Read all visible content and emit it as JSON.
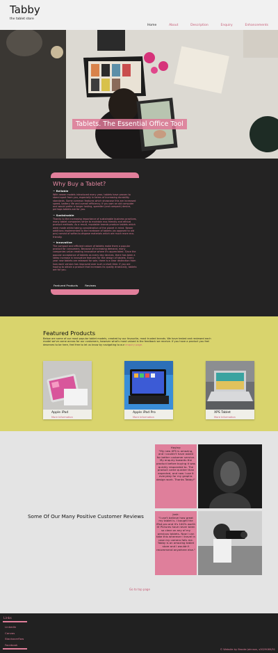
{
  "header": {
    "title": "Tabby",
    "subtitle": "the tablet store"
  },
  "nav": {
    "items": [
      "Home",
      "About",
      "Description",
      "Enquiry",
      "Enhancements"
    ]
  },
  "hero": {
    "title": "Tablets. The Essential Office Tool"
  },
  "why": {
    "heading": "Why Buy a Tablet?",
    "sections": [
      {
        "title": "~ Reliable",
        "text": "With newer models introduced every year, tablets have proven to stand apart from you, especially in terms of increasing durability standards. Some common features which showcase this are increased speed, battery life and overall efficiency. If you own an old computer and would prefer a longer lasting, speedier (and compact) device, perhaps tablets are for you."
      },
      {
        "title": "~ Sustainable",
        "text": "Thanks to the increasing importance of sustainable business practices, many tablet companies strive to maintain eco-friendly and ethical product methods. As a result, reputable brands produce tablets which were made whilst taking consideration of the planet in mind. Newer additions implemented to the hardware of tablets (as opposed to old pcs) consist of softer-to-dispose materials which are much more eco-friendly."
      },
      {
        "title": "~ Innovative",
        "text": "The compact and efficient nature of tablets make them a popular product for consumers. Because of increasing demand, many companies value creating innovative where it's appreciated. Since the popular acceptance of tablets as every day devices, there has been a steep increase in innovative features for the design of tablets. Every year new tablets are released for sale, there is a clear distinction from how each version has improved over such a short time. If you are hoping to obtain a product that increases its quality drastically, tablets are for you."
      }
    ],
    "tabs": [
      "Featured Products",
      "Reviews"
    ]
  },
  "featured": {
    "heading": "Featured Products",
    "description": "Below are some of our most popular tablet models, created by our favourite, most trusted brands. We have tested and reviewed each model we've come across for our customers, however what's most valued is the feedback we receive. If you have a product you feel deserves to be here, feel free to let us know by navigating to our ",
    "link": "enquiry page.",
    "products": [
      {
        "name": "Apple iPad",
        "more": "More Information"
      },
      {
        "name": "Apple iPad Pro",
        "more": "More Information"
      },
      {
        "name": "XPS Tablet",
        "more": "More Information"
      }
    ]
  },
  "reviews": {
    "heading": "Some Of Our Many Positive Customer Reviews",
    "items": [
      {
        "name": "Hayley:",
        "quote": "\"My new XPS is amazing, and I couldn't have asked for better customer service. My enquiry towards the product before buying it was quickly responded to. The product came quicker than expected, and now I use it everyday for my graphic design work. Thanks Tabby!\""
      },
      {
        "name": "Josh:",
        "quote": "\"I can't believe how great my tablet is. I bought the iPad pro and it's 100% worth it! Pictures have never been so clear on any of my previous tablets. Now I can take this wherever I travel in case my camera fails me. Tabby is an amazing tablet store and I wouldn't recommend anywhere else.\""
      }
    ],
    "to_top": "Go to top page"
  },
  "footer": {
    "links_label": "Links",
    "links": [
      "LinkedIn",
      "Canvas",
      "Stackoverflow",
      "Facebook"
    ],
    "copyright": "© Website by Brooke Johnson, s3029089/91"
  },
  "colors": {
    "accent_pink": "#e27f9b",
    "dark_bg": "#242323",
    "yellow_bg": "#d9d46d",
    "light_bg": "#e4e4e4"
  }
}
